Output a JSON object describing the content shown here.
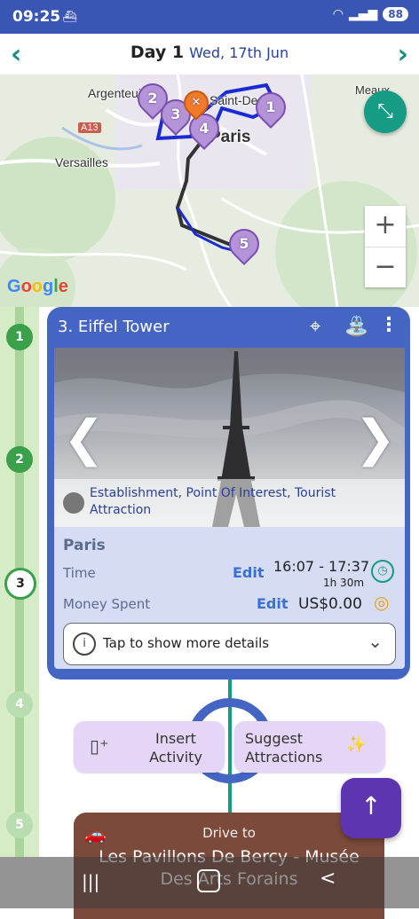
{
  "status_bar": {
    "time": "09:25",
    "battery": "88"
  },
  "header": {
    "day_label": "Day 1",
    "date": "Wed, 17th Jun"
  },
  "map": {
    "places": [
      "Argenteuil",
      "Saint-Denis",
      "Meaux",
      "A13",
      "Paris",
      "Versailles"
    ],
    "pins": [
      "2",
      "3",
      "4",
      "1",
      "5"
    ],
    "zoom_in": "+",
    "zoom_out": "−",
    "attribution": "Google"
  },
  "timeline": {
    "nodes": [
      "1",
      "2",
      "3",
      "4",
      "5"
    ]
  },
  "activity_card": {
    "title": "3. Eiffel Tower",
    "categories": "Establishment, Point Of Interest, Tourist Attraction",
    "city": "Paris",
    "time_label": "Time",
    "time_edit": "Edit",
    "time_range": "16:07 - 17:37",
    "duration": "1h 30m",
    "money_label": "Money Spent",
    "money_edit": "Edit",
    "money_value": "US$0.00",
    "details_label": "Tap to show more details"
  },
  "actions": {
    "insert": "Insert Activity",
    "suggest": "Suggest Attractions"
  },
  "drive": {
    "label": "Drive to",
    "destination": "Les Pavillons De Bercy - Musée Des Arts Forains"
  },
  "colors": {
    "primary": "#4565c4",
    "teal": "#169b85",
    "purple": "#5e35b1",
    "timeline_green": "#3aa04a"
  }
}
